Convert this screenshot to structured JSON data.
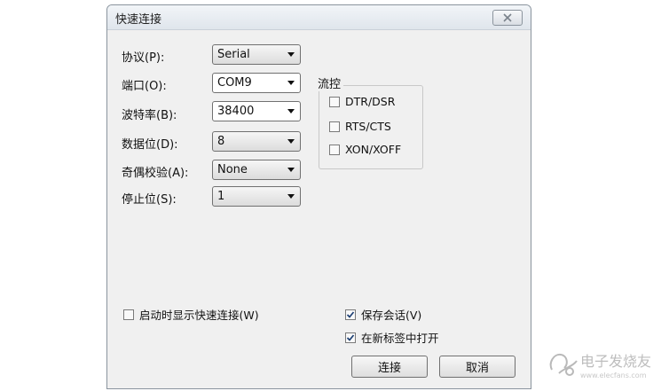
{
  "dialog": {
    "title": "快速连接"
  },
  "fields": [
    {
      "label": "协议(P):",
      "value": "Serial"
    },
    {
      "label": "端口(O):",
      "value": "COM9"
    },
    {
      "label": "波特率(B):",
      "value": "38400"
    },
    {
      "label": "数据位(D):",
      "value": "8"
    },
    {
      "label": "奇偶校验(A):",
      "value": "None"
    },
    {
      "label": "停止位(S):",
      "value": "1"
    }
  ],
  "flow_control": {
    "title": "流控",
    "options": [
      {
        "label": "DTR/DSR",
        "checked": false
      },
      {
        "label": "RTS/CTS",
        "checked": false
      },
      {
        "label": "XON/XOFF",
        "checked": false
      }
    ]
  },
  "options": {
    "show_on_startup": {
      "label": "启动时显示快速连接(W)",
      "checked": false
    },
    "save_session": {
      "label": "保存会话(V)",
      "checked": true
    },
    "open_in_new_tab": {
      "label": "在新标签中打开",
      "checked": true
    }
  },
  "buttons": {
    "connect": "连接",
    "cancel": "取消"
  },
  "watermark": {
    "text": "电子发烧友",
    "url": "www.elecfans.com"
  }
}
